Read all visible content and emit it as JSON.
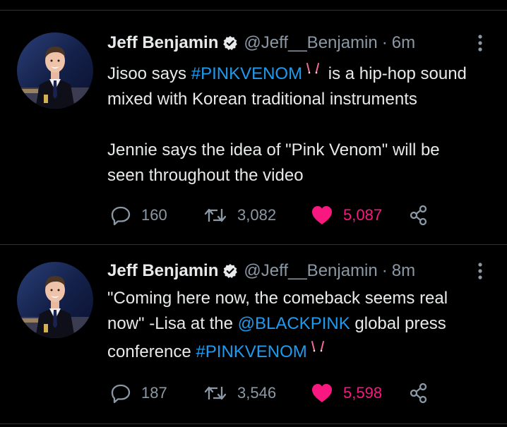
{
  "tweets": [
    {
      "author": {
        "name": "Jeff Benjamin",
        "handle": "@Jeff__Benjamin",
        "verified": true
      },
      "dot": "·",
      "time": "6m",
      "text": {
        "line1_pre": "Jisoo says ",
        "line1_hashtag": "#PINKVENOM",
        "line1_post": " is a hip-hop sound",
        "line2": "mixed with Korean traditional instruments",
        "line3": "Jennie says the idea of \"Pink Venom\" will be",
        "line4": "seen throughout the video"
      },
      "metrics": {
        "replies": "160",
        "retweets": "3,082",
        "likes": "5,087"
      }
    },
    {
      "author": {
        "name": "Jeff Benjamin",
        "handle": "@Jeff__Benjamin",
        "verified": true
      },
      "dot": "·",
      "time": "8m",
      "text": {
        "line1": "\"Coming here now, the comeback seems real",
        "line2_pre": "now\" -Lisa at the ",
        "line2_mention": "@BLACKPINK",
        "line2_post": " global press",
        "line3_pre": "conference ",
        "line3_hashtag": "#PINKVENOM"
      },
      "metrics": {
        "replies": "187",
        "retweets": "3,546",
        "likes": "5,598"
      }
    }
  ],
  "colors": {
    "background": "#000000",
    "text": "#e7e9ea",
    "secondary": "#8b98a5",
    "link": "#1d9bf0",
    "like": "#f91880",
    "divider": "#2f3336"
  },
  "icons": {
    "verified": "verified-badge-icon",
    "more": "more-vertical-icon",
    "reply": "reply-icon",
    "retweet": "retweet-icon",
    "like": "heart-filled-icon",
    "share": "share-icon",
    "hashflag": "pink-venom-hashflag-icon"
  }
}
